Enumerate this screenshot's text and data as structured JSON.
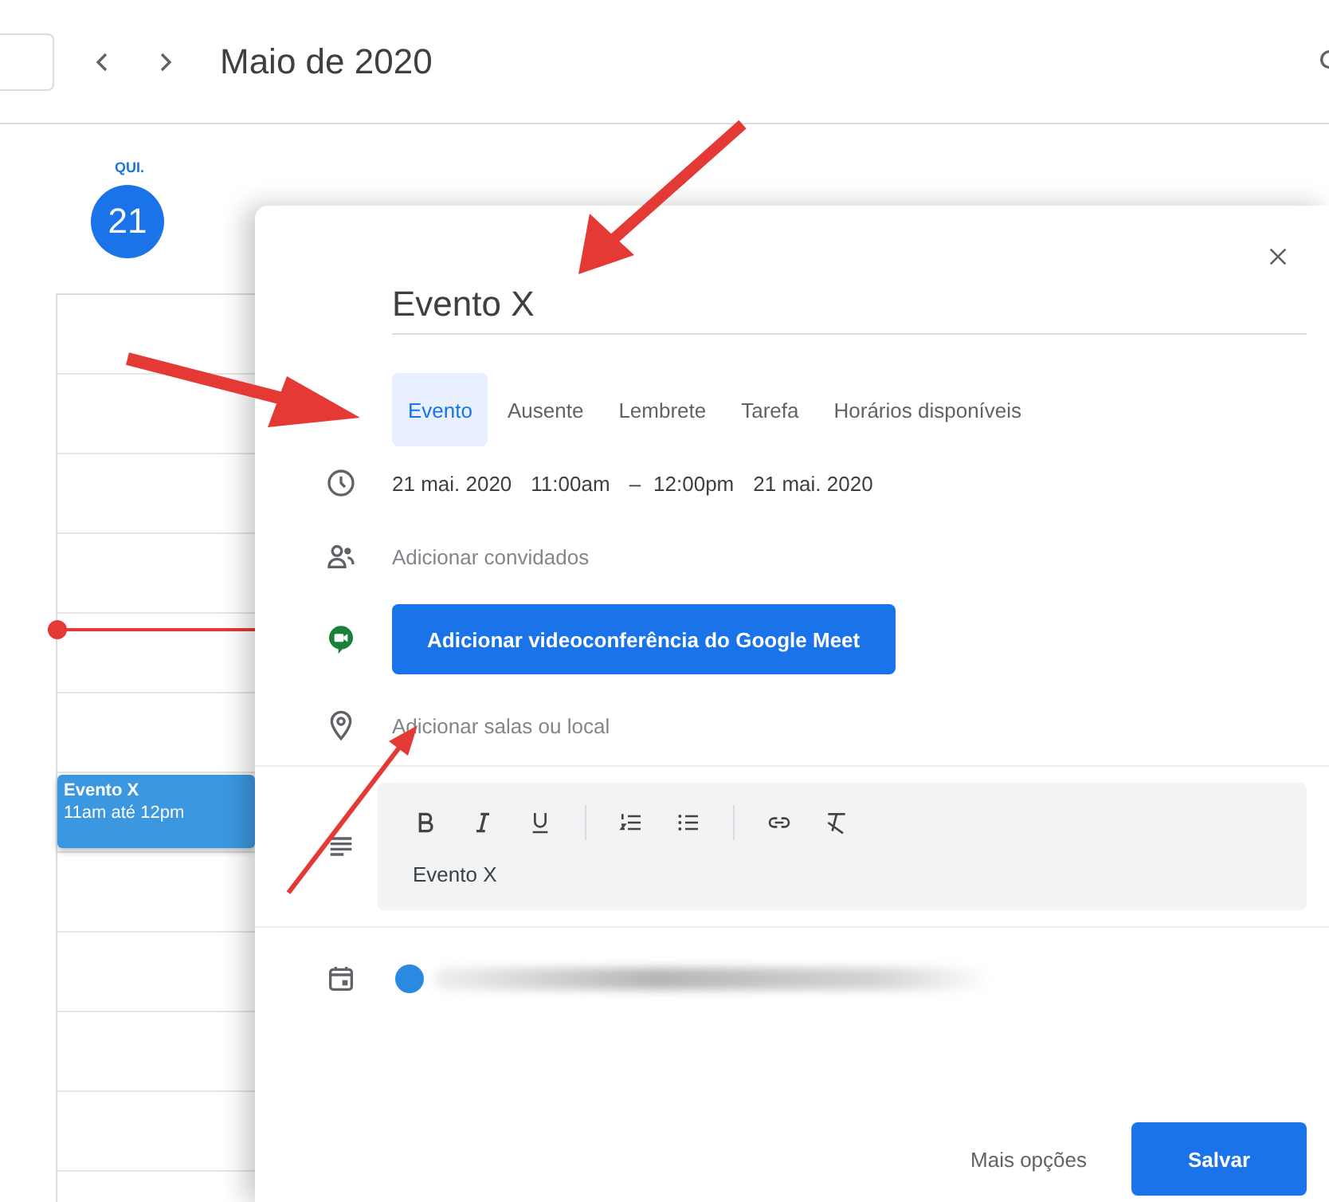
{
  "header": {
    "title": "Maio de 2020"
  },
  "day": {
    "weekday": "QUI.",
    "date": "21",
    "selected": true
  },
  "event_block": {
    "title": "Evento X",
    "time": "11am até 12pm",
    "color": "#3b98e0"
  },
  "dialog": {
    "title": "Evento X",
    "tabs": [
      {
        "label": "Evento",
        "selected": true
      },
      {
        "label": "Ausente",
        "selected": false
      },
      {
        "label": "Lembrete",
        "selected": false
      },
      {
        "label": "Tarefa",
        "selected": false
      },
      {
        "label": "Horários disponíveis",
        "selected": false
      }
    ],
    "when": {
      "start_date": "21 mai. 2020",
      "start_time": "11:00am",
      "dash": "–",
      "end_time": "12:00pm",
      "end_date": "21 mai. 2020"
    },
    "guests": {
      "placeholder": "Adicionar convidados"
    },
    "meet_button": "Adicionar videoconferência do Google Meet",
    "location": {
      "placeholder": "Adicionar salas ou local"
    },
    "description": {
      "value": "Evento X"
    },
    "calendar": {
      "color": "#2a8ae2"
    },
    "more_options": "Mais opções",
    "save": "Salvar"
  }
}
